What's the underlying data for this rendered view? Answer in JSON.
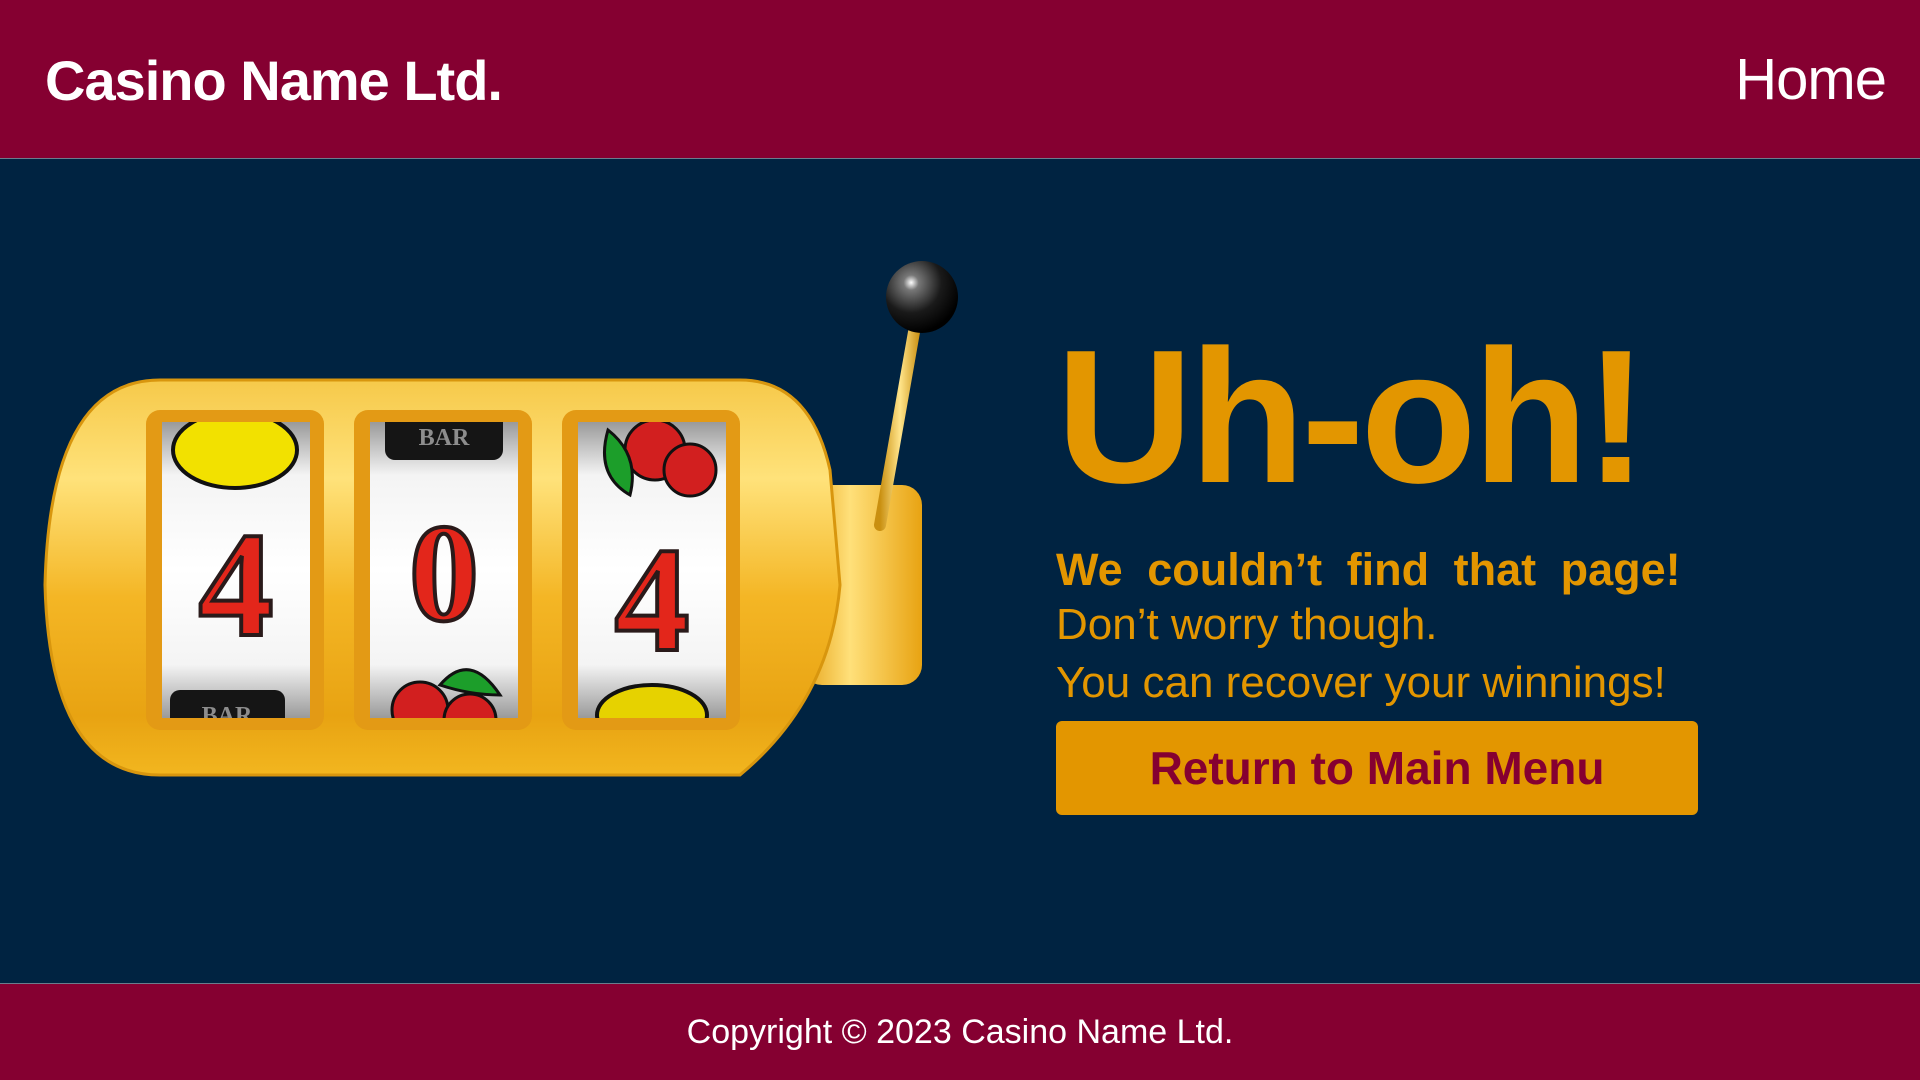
{
  "header": {
    "brand": "Casino Name Ltd.",
    "nav_home": "Home"
  },
  "slot_machine": {
    "reel_digits": [
      "4",
      "0",
      "4"
    ],
    "symbols_top": [
      "lemon",
      "bar",
      "cherries"
    ],
    "symbols_bottom": [
      "bar",
      "cherries",
      "lemon"
    ],
    "bar_label": "BAR"
  },
  "message": {
    "title": "Uh-oh!",
    "subtitle": "We couldn’t find that page!",
    "line1": "Don’t worry though.",
    "line2": "You can recover your winnings!",
    "button": "Return to Main Menu"
  },
  "footer": {
    "copyright": "Copyright © 2023 Casino Name Ltd."
  },
  "colors": {
    "header_bg": "#850031",
    "main_bg": "#002341",
    "accent": "#e39600",
    "button_text": "#850031",
    "gold": "#f2b61f"
  }
}
